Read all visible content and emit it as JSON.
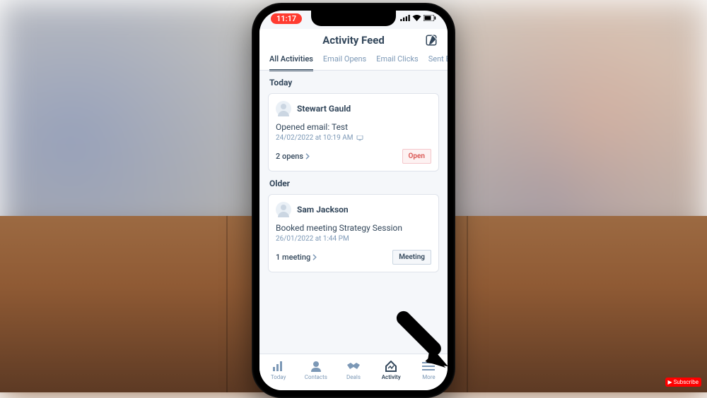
{
  "statusbar": {
    "time": "11:17"
  },
  "header": {
    "title": "Activity Feed"
  },
  "tabs": [
    {
      "label": "All Activities",
      "active": true
    },
    {
      "label": "Email Opens",
      "active": false
    },
    {
      "label": "Email Clicks",
      "active": false
    },
    {
      "label": "Sent Emai",
      "active": false
    }
  ],
  "sections": {
    "today": {
      "label": "Today",
      "card": {
        "contact": "Stewart Gauld",
        "description": "Opened email: Test",
        "timestamp": "24/02/2022 at 10:19 AM",
        "count_text": "2 opens",
        "action_label": "Open"
      }
    },
    "older": {
      "label": "Older",
      "card": {
        "contact": "Sam Jackson",
        "description": "Booked meeting Strategy Session",
        "timestamp": "26/01/2022 at 1:44 PM",
        "count_text": "1 meeting",
        "action_label": "Meeting"
      }
    }
  },
  "nav": [
    {
      "label": "Today"
    },
    {
      "label": "Contacts"
    },
    {
      "label": "Deals"
    },
    {
      "label": "Activity"
    },
    {
      "label": "More"
    }
  ]
}
